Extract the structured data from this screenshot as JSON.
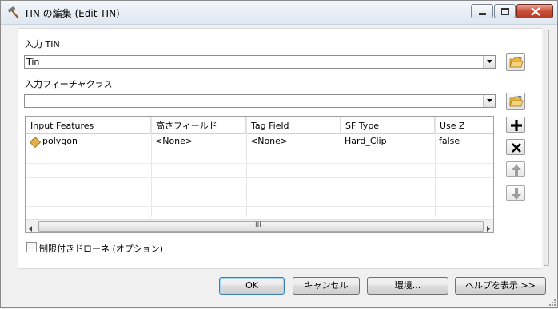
{
  "window": {
    "title": "TIN の編集 (Edit TIN)",
    "title_icon": "hammer-icon"
  },
  "input_tin": {
    "label": "入力 TIN",
    "value": "Tin"
  },
  "input_feature_class": {
    "label": "入力フィーチャクラス",
    "value": ""
  },
  "table": {
    "columns": [
      "Input Features",
      "高さフィールド",
      "Tag Field",
      "SF Type",
      "Use Z"
    ],
    "rows": [
      {
        "input_features": "polygon",
        "height_field": "<None>",
        "tag_field": "<None>",
        "sf_type": "Hard_Clip",
        "use_z": "false"
      }
    ],
    "scroll_grip": "III"
  },
  "constrained_delaunay": {
    "label": "制限付きドローネ (オプション)",
    "checked": false
  },
  "buttons": {
    "ok": "OK",
    "cancel": "キャンセル",
    "environments": "環境...",
    "show_help": "ヘルプを表示 >>"
  },
  "colors": {
    "accent_border": "#3c7fb1",
    "close_button": "#c8503a",
    "folder_yellow": "#e8b845",
    "polygon_icon": "#e0b04a"
  }
}
